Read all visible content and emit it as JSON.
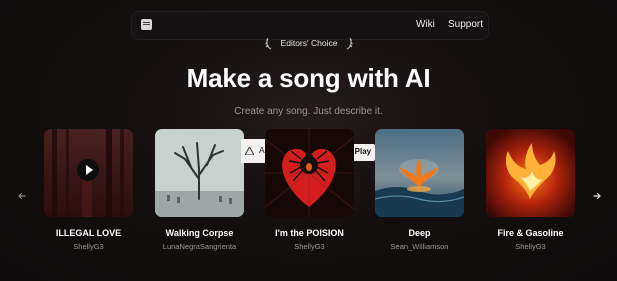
{
  "nav": {
    "wiki": "Wiki",
    "support": "Support"
  },
  "badge": "Editors' Choice",
  "hero": {
    "title": "Make a song with AI",
    "subtitle": "Create any song. Just describe it."
  },
  "overlays": {
    "left_text": "A",
    "right_text": "e Play"
  },
  "songs": [
    {
      "title": "ILLEGAL LOVE",
      "artist": "ShellyG3"
    },
    {
      "title": "Walking Corpse",
      "artist": "LunaNegraSangrienta"
    },
    {
      "title": "I'm the POISION",
      "artist": "ShellyG3"
    },
    {
      "title": "Deep",
      "artist": "Sean_Williamson"
    },
    {
      "title": "Fire & Gasoline",
      "artist": "ShellyG3"
    }
  ],
  "icons": {
    "logo": "logo-icon",
    "prev": "chevron-left-icon",
    "next": "chevron-right-icon",
    "play": "play-icon",
    "laurel": "laurel-icon"
  },
  "colors": {
    "background": "#120e0e",
    "text": "#ffffff",
    "muted": "#9b9592"
  }
}
